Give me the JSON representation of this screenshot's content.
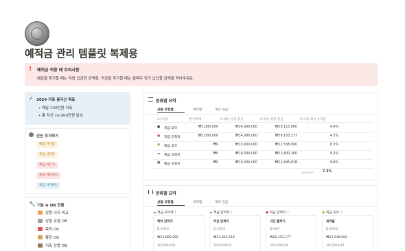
{
  "page": {
    "title": "예적금 관리 템플릿 복제용",
    "callout": {
      "mark": "!",
      "title": "예적금 적용 때 주의사항",
      "body": "예금을 추가할 때는 처음 입금한 금액을, 적금을 추가할 때는 월마다 정기 납입할 금액을 적어주세요."
    }
  },
  "goal": {
    "check_icon": "✓",
    "title": "2024 저축 총자산 목표",
    "bullets": [
      "• 매달 100만원 저축",
      "• 총 자산 10,000만원 달성"
    ]
  },
  "quick_add": {
    "title": "간단 추가하기",
    "buttons": [
      "예금 (은행)",
      "적금 (은행)",
      "예금 (만기)",
      "예금 (증권사)",
      "예금 (판매처)"
    ]
  },
  "db_list": {
    "title": "기능 & DB 모음",
    "items": [
      "상품 이자 비교",
      "상품 유형 DB",
      "목적 DB",
      "통장 DB",
      "저축 상품 DB"
    ]
  },
  "summary": {
    "title": "분류별 요약",
    "views": [
      "상품 유형별",
      "목적별",
      "계좌 현금"
    ],
    "headers": [
      "Aa 이름",
      "월 저축액",
      "Q 예상 원금 합산",
      "Q 예상 원리 합산",
      "Q 이율 예상 수익률"
    ],
    "rows": [
      {
        "name": "저금 모이",
        "monthly": "₩1,000,000",
        "principal": "₩24,000,000",
        "total": "₩26,115,000",
        "rate": "4.4%"
      },
      {
        "name": "저금 만적저",
        "monthly": "₩1,000,000",
        "principal": "₩24,000,000",
        "total": "₩26,153,177",
        "rate": "4.5%"
      },
      {
        "name": "예금 모아",
        "monthly": "₩0",
        "principal": "₩10,000,000",
        "total": "₩12,538,000",
        "rate": "8.5%"
      },
      {
        "name": "예금 모목지",
        "monthly": "₩0",
        "principal": "₩10,000,000",
        "total": "₩12,800,260",
        "rate": "9.2%"
      },
      {
        "name": "예금 모목지",
        "monthly": "₩0",
        "principal": "₩10,000,000",
        "total": "₩12,845,618",
        "rate": "9.8%"
      }
    ],
    "footer_label": "AVERAGE",
    "footer_value": "7.3%"
  },
  "board": {
    "title": "분류별 요약",
    "views": [
      "상품 유형별",
      "목적별",
      "계좌 현금"
    ],
    "groups": [
      {
        "label": "적금 모아적",
        "count": "1"
      },
      {
        "label": "적금 만적저",
        "count": "1"
      },
      {
        "label": "적금 만적지",
        "count": "1"
      },
      {
        "label": "적금 모아",
        "count": "1"
      }
    ],
    "cards": [
      {
        "name": "케이 만적지",
        "id": "D-1053",
        "amount": "₩12,800,260",
        "date": "2022/04/30"
      },
      {
        "name": "부산 만적지",
        "id": "D-1053",
        "amount": "₩12,845,618",
        "date": "2022/04/30"
      },
      {
        "name": "국민 월적지",
        "id": "D-667",
        "amount": "₩26,153,177",
        "date": "2022/04/30"
      },
      {
        "name": "새마을",
        "id": "D-1053",
        "amount": "₩12,538,000",
        "date": "2022/04/30"
      }
    ]
  },
  "colors": {
    "callout_bg": "#fde8e8",
    "callout_mark": "#d44c47",
    "goal_bg": "#e6f0f8",
    "btn_yellow_bg": "#fbf3db",
    "btn_yellow_fg": "#b08a3e",
    "btn_red_bg": "#fbe4e4",
    "btn_red_fg": "#c4554d",
    "btn_blue_bg": "#e7f3f8",
    "btn_blue_fg": "#4f86a8"
  }
}
